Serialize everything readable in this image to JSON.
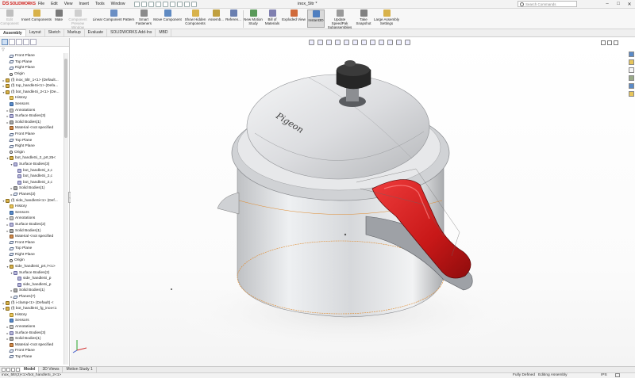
{
  "app": {
    "brand_ds": "DS",
    "brand_name": "SOLIDWORKS",
    "doc_title": "inox_5ltr *"
  },
  "menu": [
    "File",
    "Edit",
    "View",
    "Insert",
    "Tools",
    "Window"
  ],
  "search": {
    "placeholder": "Search Commands"
  },
  "ribbon": [
    {
      "label": "Edit\nComponent",
      "state": "disabled",
      "icon_color": "#bfbfbf"
    },
    {
      "label": "Insert Components",
      "state": "normal",
      "icon_color": "#d8b24a"
    },
    {
      "label": "Mate",
      "state": "normal",
      "icon_color": "#7a7a7a"
    },
    {
      "label": "Component\nPreview Window",
      "state": "disabled",
      "icon_color": "#cfcfcf"
    },
    {
      "label": "Linear Component Pattern",
      "state": "normal",
      "icon_color": "#6b8fc4"
    },
    {
      "label": "Smart\nFasteners",
      "state": "normal",
      "icon_color": "#8a8a8a"
    },
    {
      "label": "Move Component",
      "state": "normal",
      "icon_color": "#5f8ac2"
    },
    {
      "label": "Show Hidden\nComponents",
      "state": "normal",
      "icon_color": "#d8b24a"
    },
    {
      "label": "Assemb...",
      "state": "normal",
      "icon_color": "#c0a040"
    },
    {
      "label": "Referen...",
      "state": "normal",
      "icon_color": "#6a7fb0"
    },
    {
      "label": "New Motion\nStudy",
      "state": "normal",
      "icon_color": "#5a9a5a"
    },
    {
      "label": "Bill of\nMaterials",
      "state": "normal",
      "icon_color": "#8080b0"
    },
    {
      "label": "Exploded View",
      "state": "normal",
      "icon_color": "#d06a3a"
    },
    {
      "label": "Instant3D",
      "state": "selected",
      "icon_color": "#4f7fc0"
    },
    {
      "label": "Update SpeedPak\nSubassemblies",
      "state": "normal",
      "icon_color": "#9a9a9a"
    },
    {
      "label": "Take\nSnapshot",
      "state": "normal",
      "icon_color": "#808080"
    },
    {
      "label": "Large Assembly\nSettings",
      "state": "normal",
      "icon_color": "#d8b24a"
    }
  ],
  "command_tabs": [
    {
      "label": "Assembly",
      "active": true
    },
    {
      "label": "Layout",
      "active": false
    },
    {
      "label": "Sketch",
      "active": false
    },
    {
      "label": "Markup",
      "active": false
    },
    {
      "label": "Evaluate",
      "active": false
    },
    {
      "label": "SOLIDWORKS Add-Ins",
      "active": false
    },
    {
      "label": "MBD",
      "active": false
    }
  ],
  "tree": [
    {
      "label": "Front Plane",
      "level": 1,
      "icon": "plane",
      "toggle": ""
    },
    {
      "label": "Top Plane",
      "level": 1,
      "icon": "plane",
      "toggle": ""
    },
    {
      "label": "Right Plane",
      "level": 1,
      "icon": "plane",
      "toggle": ""
    },
    {
      "label": "Origin",
      "level": 1,
      "icon": "origin",
      "toggle": ""
    },
    {
      "label": "(f) inox_5ltr_1<1> (Default...",
      "level": 0,
      "icon": "part",
      "toggle": "▸"
    },
    {
      "label": "(f) top_handleSi<1> (Defa...",
      "level": 0,
      "icon": "part",
      "toggle": "▸"
    },
    {
      "label": "(f) bot_handleSi_2<1> (De...",
      "level": 0,
      "icon": "part",
      "toggle": "▾"
    },
    {
      "label": "History",
      "level": 1,
      "icon": "folder",
      "toggle": ""
    },
    {
      "label": "Sensors",
      "level": 1,
      "icon": "sensor",
      "toggle": ""
    },
    {
      "label": "Annotations",
      "level": 1,
      "icon": "annot",
      "toggle": "▸"
    },
    {
      "label": "Surface Bodies(3)",
      "level": 1,
      "icon": "surf",
      "toggle": "▸"
    },
    {
      "label": "Solid Bodies(1)",
      "level": 1,
      "icon": "body",
      "toggle": "▸"
    },
    {
      "label": "Material <not specified",
      "level": 1,
      "icon": "mat",
      "toggle": ""
    },
    {
      "label": "Front Plane",
      "level": 1,
      "icon": "plane",
      "toggle": ""
    },
    {
      "label": "Top Plane",
      "level": 1,
      "icon": "plane",
      "toggle": ""
    },
    {
      "label": "Right Plane",
      "level": 1,
      "icon": "plane",
      "toggle": ""
    },
    {
      "label": "Origin",
      "level": 1,
      "icon": "origin",
      "toggle": ""
    },
    {
      "label": "bot_handleSi_2_prt,25<",
      "level": 1,
      "icon": "part",
      "toggle": "▾"
    },
    {
      "label": "Surface Bodies(3)",
      "level": 2,
      "icon": "surf",
      "toggle": "▾"
    },
    {
      "label": "bot_handleSi_2,c",
      "level": 3,
      "icon": "surf",
      "toggle": ""
    },
    {
      "label": "bot_handleSi_2,c",
      "level": 3,
      "icon": "surf",
      "toggle": ""
    },
    {
      "label": "bot_handleSi_2,c",
      "level": 3,
      "icon": "surf",
      "toggle": ""
    },
    {
      "label": "Solid Bodies(1)",
      "level": 2,
      "icon": "body",
      "toggle": "▸"
    },
    {
      "label": "Planes(3)",
      "level": 2,
      "icon": "plane",
      "toggle": "▸"
    },
    {
      "label": "(f) side_handleSi<1> (Def...",
      "level": 0,
      "icon": "part",
      "toggle": "▾"
    },
    {
      "label": "History",
      "level": 1,
      "icon": "folder",
      "toggle": ""
    },
    {
      "label": "Sensors",
      "level": 1,
      "icon": "sensor",
      "toggle": ""
    },
    {
      "label": "Annotations",
      "level": 1,
      "icon": "annot",
      "toggle": "▸"
    },
    {
      "label": "Surface Bodies(2)",
      "level": 1,
      "icon": "surf",
      "toggle": "▸"
    },
    {
      "label": "Solid Bodies(1)",
      "level": 1,
      "icon": "body",
      "toggle": "▸"
    },
    {
      "label": "Material <not specified",
      "level": 1,
      "icon": "mat",
      "toggle": ""
    },
    {
      "label": "Front Plane",
      "level": 1,
      "icon": "plane",
      "toggle": ""
    },
    {
      "label": "Top Plane",
      "level": 1,
      "icon": "plane",
      "toggle": ""
    },
    {
      "label": "Right Plane",
      "level": 1,
      "icon": "plane",
      "toggle": ""
    },
    {
      "label": "Origin",
      "level": 1,
      "icon": "origin",
      "toggle": ""
    },
    {
      "label": "side_handleSi_prt,7<1>",
      "level": 1,
      "icon": "part",
      "toggle": "▾"
    },
    {
      "label": "Surface Bodies(2)",
      "level": 2,
      "icon": "surf",
      "toggle": "▾"
    },
    {
      "label": "side_handleSi_p",
      "level": 3,
      "icon": "surf",
      "toggle": ""
    },
    {
      "label": "side_handleSi_p",
      "level": 3,
      "icon": "surf",
      "toggle": ""
    },
    {
      "label": "Solid Bodies(1)",
      "level": 2,
      "icon": "body",
      "toggle": "▸"
    },
    {
      "label": "Planes(7)",
      "level": 2,
      "icon": "plane",
      "toggle": "▸"
    },
    {
      "label": "(f) i-clamp<1> (Default) <",
      "level": 0,
      "icon": "part",
      "toggle": "▸"
    },
    {
      "label": "(f) bot_handleSi_fg_inox<1",
      "level": 0,
      "icon": "part",
      "toggle": "▾"
    },
    {
      "label": "History",
      "level": 1,
      "icon": "folder",
      "toggle": ""
    },
    {
      "label": "Sensors",
      "level": 1,
      "icon": "sensor",
      "toggle": ""
    },
    {
      "label": "Annotations",
      "level": 1,
      "icon": "annot",
      "toggle": "▸"
    },
    {
      "label": "Surface Bodies(3)",
      "level": 1,
      "icon": "surf",
      "toggle": "▸"
    },
    {
      "label": "Solid Bodies(1)",
      "level": 1,
      "icon": "body",
      "toggle": "▸"
    },
    {
      "label": "Material <not specified",
      "level": 1,
      "icon": "mat",
      "toggle": ""
    },
    {
      "label": "Front Plane",
      "level": 1,
      "icon": "plane",
      "toggle": ""
    },
    {
      "label": "Top Plane",
      "level": 1,
      "icon": "plane",
      "toggle": ""
    }
  ],
  "viewport": {
    "lid_brand": "Pigeon",
    "handle_color": "#d81e1e",
    "steel_color": "#d9dadc"
  },
  "bottom_tabs": [
    {
      "label": "Model",
      "active": true
    },
    {
      "label": "3D Views",
      "active": false
    },
    {
      "label": "Motion Study 1",
      "active": false
    }
  ],
  "status": {
    "path": "inox_5ltr(2)<1>/bot_handleSi_2<1>",
    "defined": "Fully Defined",
    "mode": "Editing Assembly",
    "units": "IPS"
  }
}
